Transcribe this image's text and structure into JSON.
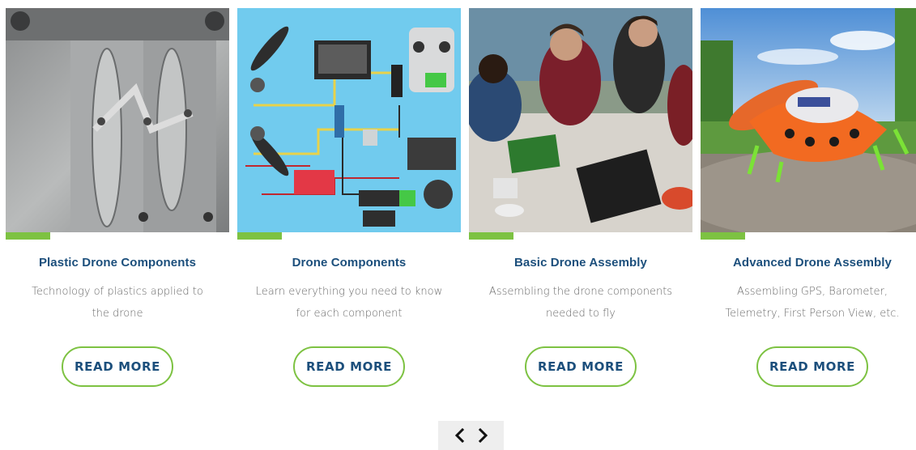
{
  "cards": [
    {
      "title": "Plastic Drone Components",
      "description": "Technology of plastics applied to the drone",
      "button_label": "READ MORE",
      "image_subject": "metal injection mold for drone propellers"
    },
    {
      "title": "Drone Components",
      "description": "Learn everything you need to know for each component",
      "button_label": "READ MORE",
      "image_subject": "illustrated drone wiring diagram with propellers, controller and screen"
    },
    {
      "title": "Basic Drone Assembly",
      "description": "Assembling the drone components needed to fly",
      "button_label": "READ MORE",
      "image_subject": "students assembling drones at a workshop table"
    },
    {
      "title": "Advanced Drone Assembly",
      "description": "Assembling GPS, Barometer, Telemetry, First Person View, etc.",
      "button_label": "READ MORE",
      "image_subject": "orange drone sitting on a rock outdoors"
    }
  ],
  "carousel_nav": {
    "prev_icon": "chevron-left-icon",
    "next_icon": "chevron-right-icon"
  },
  "colors": {
    "accent": "#7dc242",
    "title": "#1c4f7c",
    "text": "#6a6a6a",
    "nav_bg": "#eeeeee"
  }
}
